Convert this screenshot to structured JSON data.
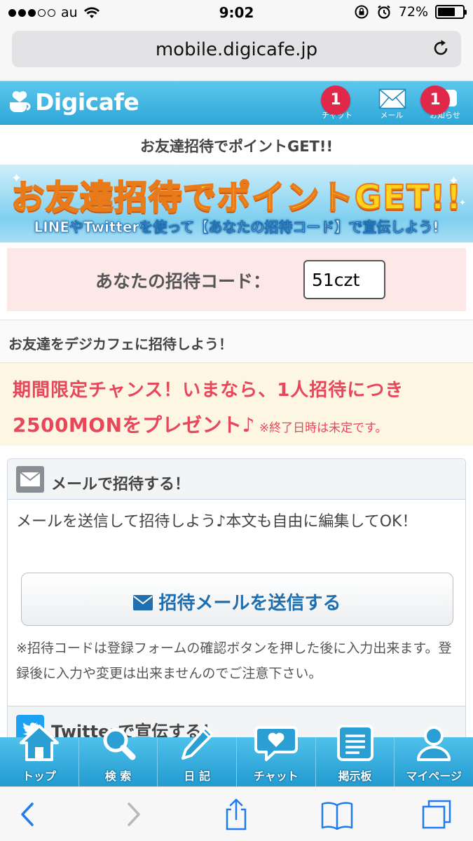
{
  "status_bar": {
    "carrier": "au",
    "time": "9:02",
    "battery_percent": "72%",
    "battery_level": 0.72
  },
  "browser": {
    "url": "mobile.digicafe.jp"
  },
  "header": {
    "logo": "Digicafe",
    "nav": [
      {
        "label": "チャット",
        "icon": "chat-icon",
        "badge": "1"
      },
      {
        "label": "メール",
        "icon": "mail-icon",
        "badge": ""
      },
      {
        "label": "お知らせ",
        "icon": "notice-icon",
        "badge": "1"
      }
    ]
  },
  "page": {
    "title": "お友達招待でポイントGET!!",
    "banner": {
      "headline": "お友達招待でポイントGET!!",
      "sub": "LINEやTwitterを使って【あなたの招待コード】で宣伝しよう!"
    },
    "code_label": "あなたの招待コード：",
    "code_value": "51czt",
    "invite_heading": "お友達をデジカフェに招待しよう！",
    "promo": {
      "line1": "期間限定チャンス！いまなら、1人招待につき",
      "line2": "2500MONをプレゼント♪",
      "note": "※終了日時は未定です。"
    },
    "mail_section": {
      "title": "メールで招待する！",
      "body": "メールを送信して招待しよう♪本文も自由に編集してOK！",
      "button": "招待メールを送信する",
      "note": "※招待コードは登録フォームの確認ボタンを押した後に入力出来ます。登録後に入力や変更は出来ませんのでご注意下さい。"
    },
    "twitter_section": {
      "title": "Twitterで宣伝する！"
    }
  },
  "bottom_nav": [
    {
      "label": "トップ",
      "icon": "home-icon"
    },
    {
      "label": "検 索",
      "icon": "search-icon"
    },
    {
      "label": "日 記",
      "icon": "pencil-icon"
    },
    {
      "label": "チャット",
      "icon": "heart-chat-icon"
    },
    {
      "label": "掲示板",
      "icon": "board-icon"
    },
    {
      "label": "マイページ",
      "icon": "person-icon"
    }
  ],
  "colors": {
    "header_blue": "#2ea7d8",
    "badge_red": "#e0294a",
    "promo_red": "#e8465b",
    "link_blue": "#1f6fb0"
  }
}
